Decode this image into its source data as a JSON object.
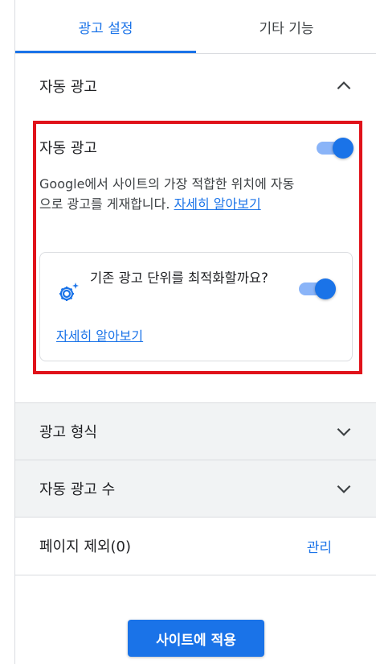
{
  "tabs": [
    {
      "label": "광고 설정",
      "active": true
    },
    {
      "label": "기타 기능",
      "active": false
    }
  ],
  "auto_ads_section": {
    "title": "자동 광고",
    "expanded": true,
    "setting_title": "자동 광고",
    "toggle_on": true,
    "description": "Google에서 사이트의 가장 적합한 위치에 자동으로 광고를 게재합니다.",
    "learn_more": "자세히 알아보기",
    "card": {
      "icon": "settings-sparkle-icon",
      "text": "기존 광고 단위를 최적화할까요?",
      "toggle_on": true,
      "learn_more": "자세히 알아보기"
    }
  },
  "ad_formats": {
    "title": "광고 형식",
    "expanded": false
  },
  "ad_load": {
    "title": "자동 광고 수",
    "expanded": false
  },
  "page_exclusions": {
    "title": "페이지 제외(0)",
    "action": "관리"
  },
  "apply_button": "사이트에 적용",
  "colors": {
    "accent": "#1a73e8",
    "highlight_border": "#e0121a",
    "toggle_track": "#8ab4f8",
    "collapsed_bg": "#f1f3f4"
  }
}
